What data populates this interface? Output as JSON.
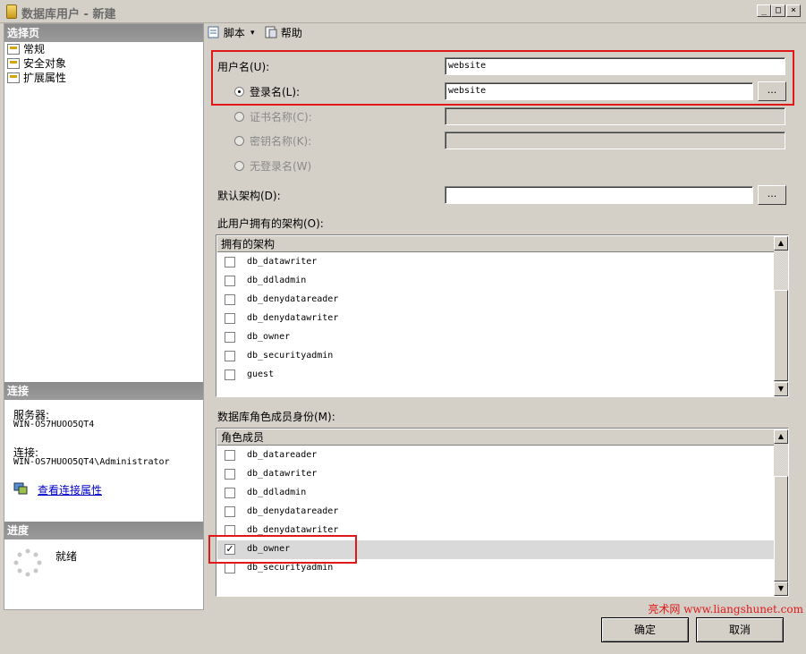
{
  "window": {
    "title": "数据库用户 - 新建",
    "min_glyph": "_",
    "max_glyph": "□",
    "close_glyph": "×"
  },
  "left": {
    "select_page_header": "选择页",
    "pages": [
      {
        "label": "常规",
        "icon": "page-icon"
      },
      {
        "label": "安全对象",
        "icon": "page-icon"
      },
      {
        "label": "扩展属性",
        "icon": "page-icon"
      }
    ],
    "connection_header": "连接",
    "server_label": "服务器:",
    "server_value": "WIN-OS7HUOO5QT4",
    "connection_label": "连接:",
    "connection_value": "WIN-OS7HUOO5QT4\\Administrator",
    "view_connection_link": "查看连接属性",
    "progress_header": "进度",
    "progress_status": "就绪"
  },
  "toolbar": {
    "script_label": "脚本",
    "script_dropdown_glyph": "▾",
    "help_label": "帮助"
  },
  "form": {
    "username_label": "用户名(U):",
    "username_value": "website",
    "login_label": "登录名(L):",
    "login_value": "website",
    "cert_label": "证书名称(C):",
    "key_label": "密钥名称(K):",
    "nologin_label": "无登录名(W)",
    "default_schema_label": "默认架构(D):",
    "default_schema_value": "",
    "browse_label": "...",
    "owned_schemas_label": "此用户拥有的架构(O):",
    "owned_schemas_header": "拥有的架构",
    "owned_schemas": [
      {
        "name": "db_datawriter",
        "checked": false
      },
      {
        "name": "db_ddladmin",
        "checked": false
      },
      {
        "name": "db_denydatareader",
        "checked": false
      },
      {
        "name": "db_denydatawriter",
        "checked": false
      },
      {
        "name": "db_owner",
        "checked": false
      },
      {
        "name": "db_securityadmin",
        "checked": false
      },
      {
        "name": "guest",
        "checked": false
      }
    ],
    "roles_label": "数据库角色成员身份(M):",
    "roles_header": "角色成员",
    "roles": [
      {
        "name": "db_datareader",
        "checked": false
      },
      {
        "name": "db_datawriter",
        "checked": false
      },
      {
        "name": "db_ddladmin",
        "checked": false
      },
      {
        "name": "db_denydatareader",
        "checked": false
      },
      {
        "name": "db_denydatawriter",
        "checked": false
      },
      {
        "name": "db_owner",
        "checked": true
      },
      {
        "name": "db_securityadmin",
        "checked": false
      }
    ],
    "check_glyph": "✓",
    "scroll_up_glyph": "▲",
    "scroll_down_glyph": "▼"
  },
  "footer": {
    "ok_label": "确定",
    "cancel_label": "取消",
    "watermark": "亮术网 www.liangshunet.com"
  },
  "colors": {
    "highlight_box": "#e01818",
    "section_header": "#8b8b8b",
    "link": "#0000cc"
  }
}
